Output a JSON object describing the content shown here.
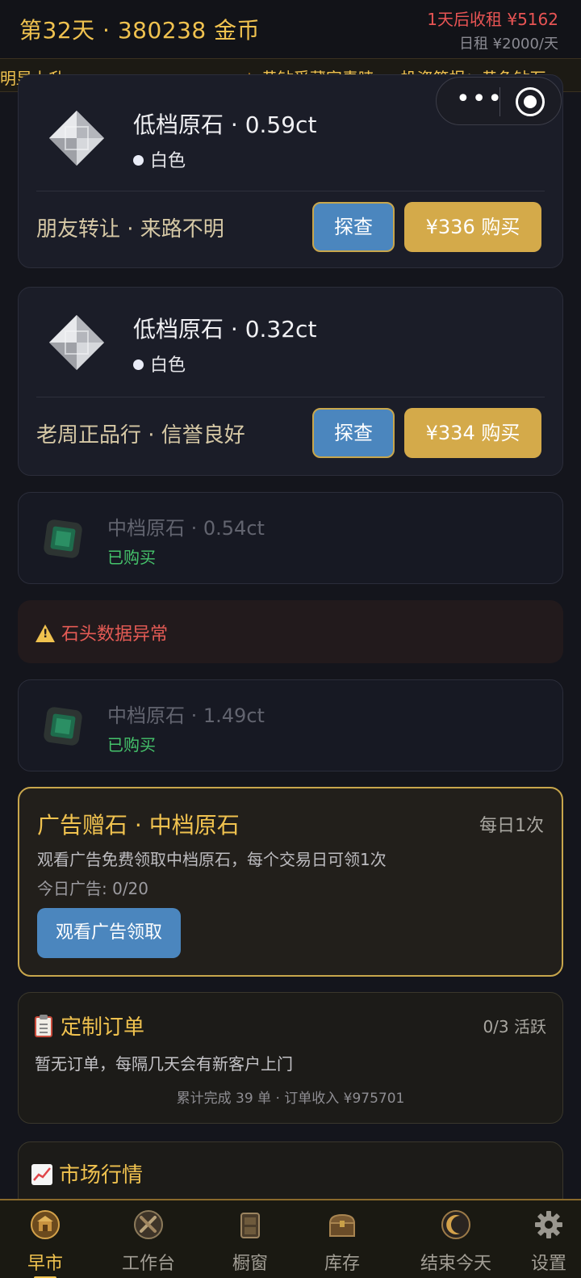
{
  "header": {
    "day_coins": "第32天 · 380238 金币",
    "rent_due": "1天后收租 ¥5162",
    "daily_rent": "日租 ¥2000/天"
  },
  "ticker": {
    "tail": "明显上升。",
    "headline": "黄钻受藏家青睐 — 投资简报：黄色钻石"
  },
  "listings": [
    {
      "title": "低档原石 · 0.59ct",
      "color": "白色",
      "source": "朋友转让 · 来路不明",
      "inspect_label": "探查",
      "buy_label": "¥336 购买"
    },
    {
      "title": "低档原石 · 0.32ct",
      "color": "白色",
      "source": "老周正品行 · 信誉良好",
      "inspect_label": "探查",
      "buy_label": "¥334 购买"
    }
  ],
  "bought": [
    {
      "title": "中档原石 · 0.54ct",
      "status": "已购买"
    },
    {
      "title": "中档原石 · 1.49ct",
      "status": "已购买"
    }
  ],
  "warning": {
    "text": "石头数据异常"
  },
  "ad": {
    "title": "广告赠石 · 中档原石",
    "frequency": "每日1次",
    "description": "观看广告免费领取中档原石，每个交易日可领1次",
    "count": "今日广告: 0/20",
    "button": "观看广告领取"
  },
  "orders": {
    "title": "定制订单",
    "active": "0/3 活跃",
    "empty": "暂无订单，每隔几天会有新客户上门",
    "stats": "累计完成 39 单 · 订单收入 ¥975701"
  },
  "market": {
    "title": "市场行情"
  },
  "nav": [
    {
      "label": "早市",
      "icon": "market-stall-icon",
      "active": true
    },
    {
      "label": "工作台",
      "icon": "workbench-tools-icon",
      "active": false
    },
    {
      "label": "橱窗",
      "icon": "display-case-icon",
      "active": false
    },
    {
      "label": "库存",
      "icon": "treasure-chest-icon",
      "active": false
    },
    {
      "label": "结束今天",
      "icon": "moon-end-day-icon",
      "active": false
    },
    {
      "label": "设置",
      "icon": "gear-icon",
      "active": false
    }
  ],
  "colors": {
    "gold": "#f0c24f",
    "inspect_blue": "#4b86be",
    "buy_gold": "#d4aa4a",
    "danger": "#e55b55",
    "success": "#45c36b"
  }
}
